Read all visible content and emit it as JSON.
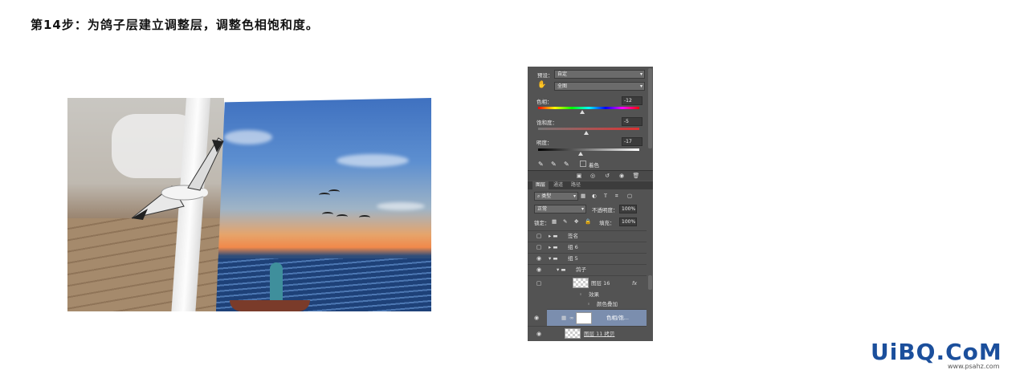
{
  "heading": "第14步：为鸽子层建立调整层，调整色相饱和度。",
  "panel": {
    "preset_label": "预设：",
    "preset_value": "自定",
    "channel_value": "全图",
    "hue_label": "色相：",
    "hue_value": "-12",
    "saturation_label": "饱和度：",
    "saturation_value": "-5",
    "lightness_label": "明度：",
    "lightness_value": "-17",
    "hue_knob_fraction": 0.44,
    "saturation_knob_fraction": 0.48,
    "lightness_knob_fraction": 0.42,
    "colorize_label": "着色",
    "tabs": [
      "图层",
      "通道",
      "路径"
    ],
    "filter_kind": "类型",
    "blend_mode": "正常",
    "opacity_label": "不透明度：",
    "opacity_value": "100%",
    "lock_label": "锁定：",
    "fill_label": "填充：",
    "fill_value": "100%",
    "layers": [
      "签名",
      "组 6",
      "组 5",
      "鸽子",
      "图层 16",
      "效果",
      "颜色叠加",
      "色相/饱...",
      "图层 11 拷贝"
    ],
    "fx_label": "fx"
  },
  "watermark": {
    "brand_main": "UiBQ.CoM",
    "brand_url": "www.psahz.com"
  },
  "colors": {
    "panel_bg": "#535353",
    "selected_layer": "#7b8eae",
    "watermark_blue": "#1b4f9c",
    "watermark_green": "#3aa64a"
  }
}
